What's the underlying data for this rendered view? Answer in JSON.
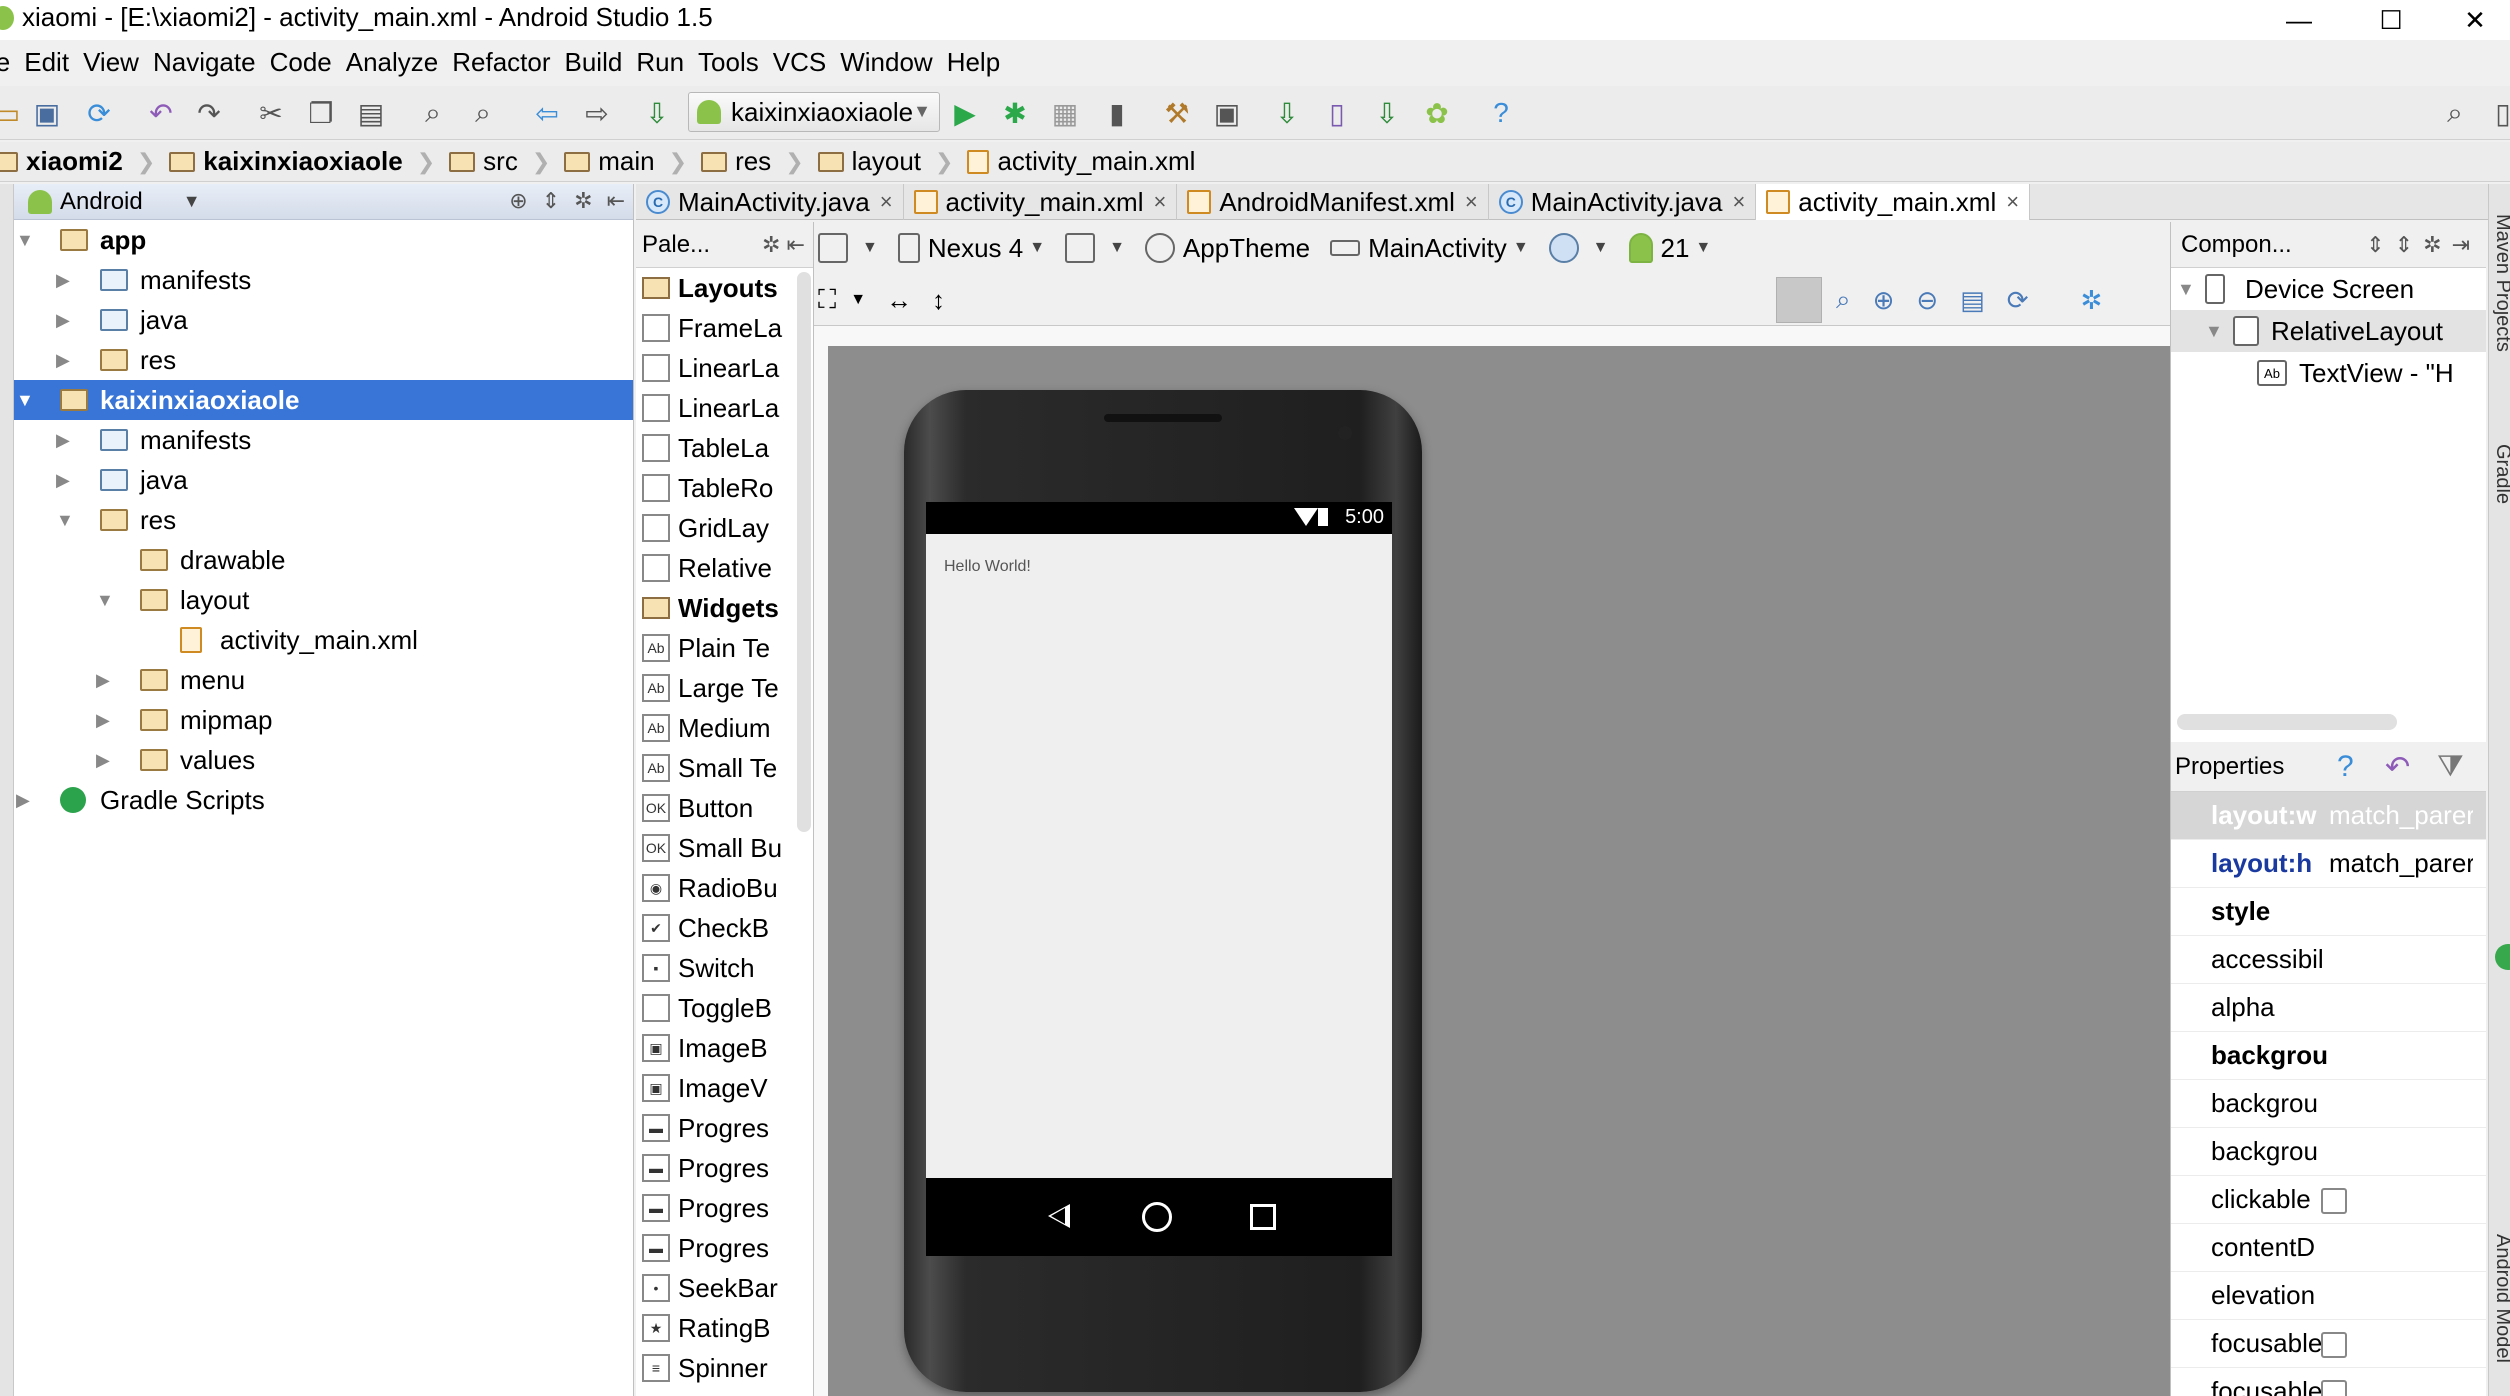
{
  "window": {
    "title": "xiaomi - [E:\\xiaomi2] - activity_main.xml - Android Studio 1.5",
    "minimize": "—",
    "maximize": "☐",
    "close": "✕"
  },
  "menu": [
    "le",
    "Edit",
    "View",
    "Navigate",
    "Code",
    "Analyze",
    "Refactor",
    "Build",
    "Run",
    "Tools",
    "VCS",
    "Window",
    "Help"
  ],
  "toolbar": {
    "run_config": "kaixinxiaoxiaole"
  },
  "breadcrumb": [
    "xiaomi2",
    "kaixinxiaoxiaole",
    "src",
    "main",
    "res",
    "layout",
    "activity_main.xml"
  ],
  "project": {
    "view_mode": "Android",
    "tree": [
      {
        "label": "app",
        "level": 0,
        "expanded": true,
        "icon": "module-folder"
      },
      {
        "label": "manifests",
        "level": 1,
        "expanded": false,
        "icon": "folder"
      },
      {
        "label": "java",
        "level": 1,
        "expanded": false,
        "icon": "folder"
      },
      {
        "label": "res",
        "level": 1,
        "expanded": false,
        "icon": "res-folder"
      },
      {
        "label": "kaixinxiaoxiaole",
        "level": 0,
        "expanded": true,
        "icon": "module-folder",
        "selected": true
      },
      {
        "label": "manifests",
        "level": 1,
        "expanded": false,
        "icon": "folder"
      },
      {
        "label": "java",
        "level": 1,
        "expanded": false,
        "icon": "folder"
      },
      {
        "label": "res",
        "level": 1,
        "expanded": true,
        "icon": "res-folder"
      },
      {
        "label": "drawable",
        "level": 2,
        "expanded": null,
        "icon": "res-folder"
      },
      {
        "label": "layout",
        "level": 2,
        "expanded": true,
        "icon": "res-folder"
      },
      {
        "label": "activity_main.xml",
        "level": 3,
        "expanded": null,
        "icon": "xml-file"
      },
      {
        "label": "menu",
        "level": 2,
        "expanded": false,
        "icon": "res-folder"
      },
      {
        "label": "mipmap",
        "level": 2,
        "expanded": false,
        "icon": "res-folder"
      },
      {
        "label": "values",
        "level": 2,
        "expanded": false,
        "icon": "res-folder"
      },
      {
        "label": "Gradle Scripts",
        "level": 0,
        "expanded": false,
        "icon": "gradle"
      }
    ]
  },
  "tabs": [
    {
      "label": "MainActivity.java",
      "kind": "java",
      "active": false
    },
    {
      "label": "activity_main.xml",
      "kind": "xml",
      "active": false
    },
    {
      "label": "AndroidManifest.xml",
      "kind": "xml",
      "active": false
    },
    {
      "label": "MainActivity.java",
      "kind": "java",
      "active": false
    },
    {
      "label": "activity_main.xml",
      "kind": "xml",
      "active": true
    }
  ],
  "palette": {
    "title": "Pale...",
    "items": [
      {
        "label": "Layouts",
        "group": true,
        "icon": ""
      },
      {
        "label": "FrameLa",
        "group": false,
        "icon": ""
      },
      {
        "label": "LinearLa",
        "group": false,
        "icon": ""
      },
      {
        "label": "LinearLa",
        "group": false,
        "icon": ""
      },
      {
        "label": "TableLa",
        "group": false,
        "icon": ""
      },
      {
        "label": "TableRo",
        "group": false,
        "icon": ""
      },
      {
        "label": "GridLay",
        "group": false,
        "icon": ""
      },
      {
        "label": "Relative",
        "group": false,
        "icon": ""
      },
      {
        "label": "Widgets",
        "group": true,
        "icon": ""
      },
      {
        "label": "Plain Te",
        "group": false,
        "icon": "Ab"
      },
      {
        "label": "Large Te",
        "group": false,
        "icon": "Ab"
      },
      {
        "label": "Medium",
        "group": false,
        "icon": "Ab"
      },
      {
        "label": "Small Te",
        "group": false,
        "icon": "Ab"
      },
      {
        "label": "Button",
        "group": false,
        "icon": "OK"
      },
      {
        "label": "Small Bu",
        "group": false,
        "icon": "OK"
      },
      {
        "label": "RadioBu",
        "group": false,
        "icon": "◉"
      },
      {
        "label": "CheckB",
        "group": false,
        "icon": "✔"
      },
      {
        "label": "Switch",
        "group": false,
        "icon": "▪"
      },
      {
        "label": "ToggleB",
        "group": false,
        "icon": ""
      },
      {
        "label": "ImageB",
        "group": false,
        "icon": "▣"
      },
      {
        "label": "ImageV",
        "group": false,
        "icon": "▣"
      },
      {
        "label": "Progres",
        "group": false,
        "icon": "▬"
      },
      {
        "label": "Progres",
        "group": false,
        "icon": "▬"
      },
      {
        "label": "Progres",
        "group": false,
        "icon": "▬"
      },
      {
        "label": "Progres",
        "group": false,
        "icon": "▬"
      },
      {
        "label": "SeekBar",
        "group": false,
        "icon": "•"
      },
      {
        "label": "RatingB",
        "group": false,
        "icon": "★"
      },
      {
        "label": "Spinner",
        "group": false,
        "icon": "≡"
      }
    ]
  },
  "editor_toolbar": {
    "device": "Nexus 4",
    "theme": "AppTheme",
    "activity": "MainActivity",
    "api": "21"
  },
  "device_screen": {
    "time": "5:00",
    "hello_text": "Hello World!"
  },
  "component_tree": {
    "title": "Compon...",
    "rows": [
      {
        "label": "Device Screen",
        "level": 0
      },
      {
        "label": "RelativeLayout",
        "level": 1
      },
      {
        "label": "TextView - \"H",
        "level": 2
      }
    ]
  },
  "properties": {
    "title": "Properties",
    "rows": [
      {
        "name": "layout:w",
        "value": "match_parer",
        "style": "hdr"
      },
      {
        "name": "layout:h",
        "value": "match_parer",
        "style": "blue"
      },
      {
        "name": "style",
        "value": "",
        "style": "bold"
      },
      {
        "name": "accessibil",
        "value": "",
        "style": ""
      },
      {
        "name": "alpha",
        "value": "",
        "style": ""
      },
      {
        "name": "backgrou",
        "value": "",
        "style": "bold"
      },
      {
        "name": "backgrou",
        "value": "",
        "style": ""
      },
      {
        "name": "backgrou",
        "value": "",
        "style": ""
      },
      {
        "name": "clickable",
        "value": "",
        "style": "",
        "checkbox": true
      },
      {
        "name": "contentD",
        "value": "",
        "style": ""
      },
      {
        "name": "elevation",
        "value": "",
        "style": ""
      },
      {
        "name": "focusable",
        "value": "",
        "style": "",
        "checkbox": true
      },
      {
        "name": "focusable",
        "value": "",
        "style": "",
        "checkbox": true
      }
    ]
  },
  "side_tools": {
    "right": [
      "Maven Projects",
      "Gradle",
      "Android Model"
    ]
  }
}
